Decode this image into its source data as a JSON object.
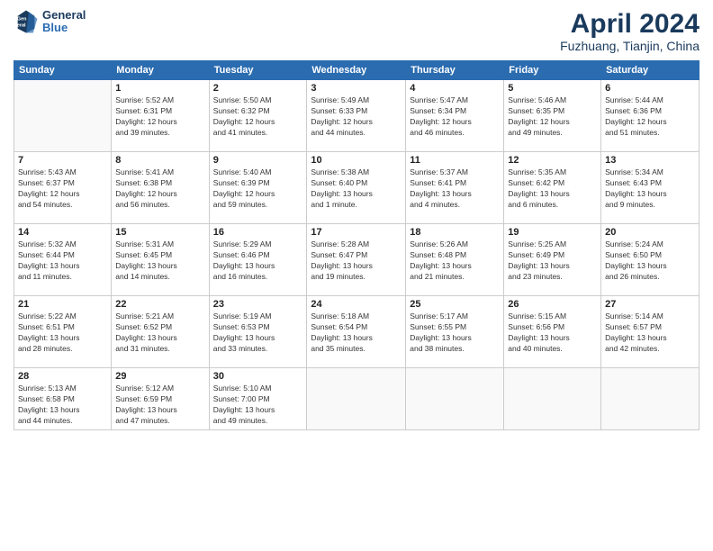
{
  "header": {
    "logo_line1": "General",
    "logo_line2": "Blue",
    "month": "April 2024",
    "location": "Fuzhuang, Tianjin, China"
  },
  "weekdays": [
    "Sunday",
    "Monday",
    "Tuesday",
    "Wednesday",
    "Thursday",
    "Friday",
    "Saturday"
  ],
  "weeks": [
    [
      {
        "day": "",
        "info": ""
      },
      {
        "day": "1",
        "info": "Sunrise: 5:52 AM\nSunset: 6:31 PM\nDaylight: 12 hours\nand 39 minutes."
      },
      {
        "day": "2",
        "info": "Sunrise: 5:50 AM\nSunset: 6:32 PM\nDaylight: 12 hours\nand 41 minutes."
      },
      {
        "day": "3",
        "info": "Sunrise: 5:49 AM\nSunset: 6:33 PM\nDaylight: 12 hours\nand 44 minutes."
      },
      {
        "day": "4",
        "info": "Sunrise: 5:47 AM\nSunset: 6:34 PM\nDaylight: 12 hours\nand 46 minutes."
      },
      {
        "day": "5",
        "info": "Sunrise: 5:46 AM\nSunset: 6:35 PM\nDaylight: 12 hours\nand 49 minutes."
      },
      {
        "day": "6",
        "info": "Sunrise: 5:44 AM\nSunset: 6:36 PM\nDaylight: 12 hours\nand 51 minutes."
      }
    ],
    [
      {
        "day": "7",
        "info": "Sunrise: 5:43 AM\nSunset: 6:37 PM\nDaylight: 12 hours\nand 54 minutes."
      },
      {
        "day": "8",
        "info": "Sunrise: 5:41 AM\nSunset: 6:38 PM\nDaylight: 12 hours\nand 56 minutes."
      },
      {
        "day": "9",
        "info": "Sunrise: 5:40 AM\nSunset: 6:39 PM\nDaylight: 12 hours\nand 59 minutes."
      },
      {
        "day": "10",
        "info": "Sunrise: 5:38 AM\nSunset: 6:40 PM\nDaylight: 13 hours\nand 1 minute."
      },
      {
        "day": "11",
        "info": "Sunrise: 5:37 AM\nSunset: 6:41 PM\nDaylight: 13 hours\nand 4 minutes."
      },
      {
        "day": "12",
        "info": "Sunrise: 5:35 AM\nSunset: 6:42 PM\nDaylight: 13 hours\nand 6 minutes."
      },
      {
        "day": "13",
        "info": "Sunrise: 5:34 AM\nSunset: 6:43 PM\nDaylight: 13 hours\nand 9 minutes."
      }
    ],
    [
      {
        "day": "14",
        "info": "Sunrise: 5:32 AM\nSunset: 6:44 PM\nDaylight: 13 hours\nand 11 minutes."
      },
      {
        "day": "15",
        "info": "Sunrise: 5:31 AM\nSunset: 6:45 PM\nDaylight: 13 hours\nand 14 minutes."
      },
      {
        "day": "16",
        "info": "Sunrise: 5:29 AM\nSunset: 6:46 PM\nDaylight: 13 hours\nand 16 minutes."
      },
      {
        "day": "17",
        "info": "Sunrise: 5:28 AM\nSunset: 6:47 PM\nDaylight: 13 hours\nand 19 minutes."
      },
      {
        "day": "18",
        "info": "Sunrise: 5:26 AM\nSunset: 6:48 PM\nDaylight: 13 hours\nand 21 minutes."
      },
      {
        "day": "19",
        "info": "Sunrise: 5:25 AM\nSunset: 6:49 PM\nDaylight: 13 hours\nand 23 minutes."
      },
      {
        "day": "20",
        "info": "Sunrise: 5:24 AM\nSunset: 6:50 PM\nDaylight: 13 hours\nand 26 minutes."
      }
    ],
    [
      {
        "day": "21",
        "info": "Sunrise: 5:22 AM\nSunset: 6:51 PM\nDaylight: 13 hours\nand 28 minutes."
      },
      {
        "day": "22",
        "info": "Sunrise: 5:21 AM\nSunset: 6:52 PM\nDaylight: 13 hours\nand 31 minutes."
      },
      {
        "day": "23",
        "info": "Sunrise: 5:19 AM\nSunset: 6:53 PM\nDaylight: 13 hours\nand 33 minutes."
      },
      {
        "day": "24",
        "info": "Sunrise: 5:18 AM\nSunset: 6:54 PM\nDaylight: 13 hours\nand 35 minutes."
      },
      {
        "day": "25",
        "info": "Sunrise: 5:17 AM\nSunset: 6:55 PM\nDaylight: 13 hours\nand 38 minutes."
      },
      {
        "day": "26",
        "info": "Sunrise: 5:15 AM\nSunset: 6:56 PM\nDaylight: 13 hours\nand 40 minutes."
      },
      {
        "day": "27",
        "info": "Sunrise: 5:14 AM\nSunset: 6:57 PM\nDaylight: 13 hours\nand 42 minutes."
      }
    ],
    [
      {
        "day": "28",
        "info": "Sunrise: 5:13 AM\nSunset: 6:58 PM\nDaylight: 13 hours\nand 44 minutes."
      },
      {
        "day": "29",
        "info": "Sunrise: 5:12 AM\nSunset: 6:59 PM\nDaylight: 13 hours\nand 47 minutes."
      },
      {
        "day": "30",
        "info": "Sunrise: 5:10 AM\nSunset: 7:00 PM\nDaylight: 13 hours\nand 49 minutes."
      },
      {
        "day": "",
        "info": ""
      },
      {
        "day": "",
        "info": ""
      },
      {
        "day": "",
        "info": ""
      },
      {
        "day": "",
        "info": ""
      }
    ]
  ]
}
